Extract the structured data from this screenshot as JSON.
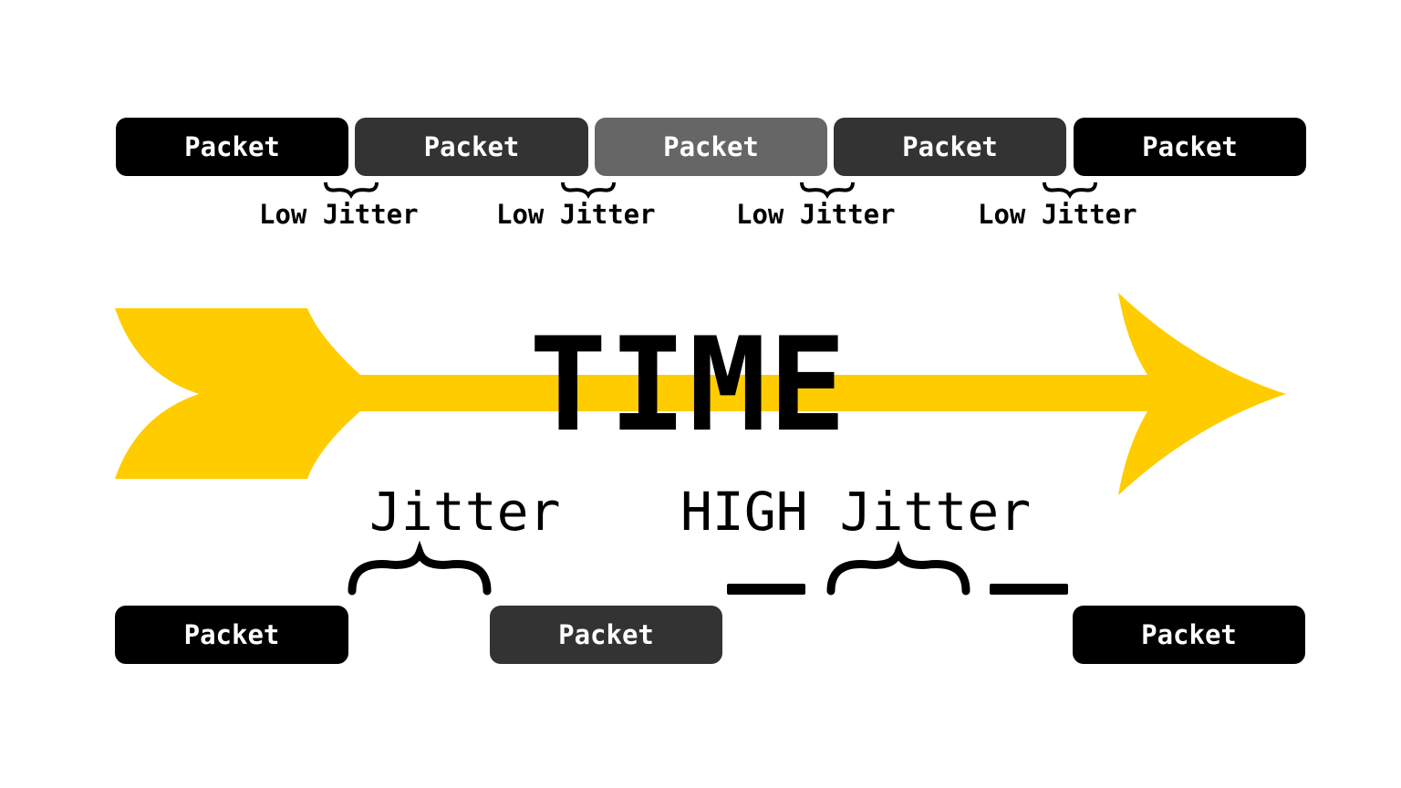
{
  "title": "TIME",
  "colors": {
    "arrow": "#FFCC00",
    "packet_black": "#000000",
    "packet_dark": "#333333",
    "packet_mid": "#666666"
  },
  "top_row": {
    "packets": [
      {
        "label": "Packet",
        "shade": "black"
      },
      {
        "label": "Packet",
        "shade": "dark"
      },
      {
        "label": "Packet",
        "shade": "mid"
      },
      {
        "label": "Packet",
        "shade": "dark"
      },
      {
        "label": "Packet",
        "shade": "black"
      }
    ],
    "gap_labels": [
      "Low Jitter",
      "Low Jitter",
      "Low Jitter",
      "Low Jitter"
    ]
  },
  "bottom_row": {
    "packets": [
      {
        "label": "Packet",
        "shade": "black"
      },
      {
        "label": "Packet",
        "shade": "dark"
      },
      {
        "label": "Packet",
        "shade": "black"
      }
    ],
    "gap_labels": [
      "Jitter",
      "HIGH Jitter"
    ]
  }
}
